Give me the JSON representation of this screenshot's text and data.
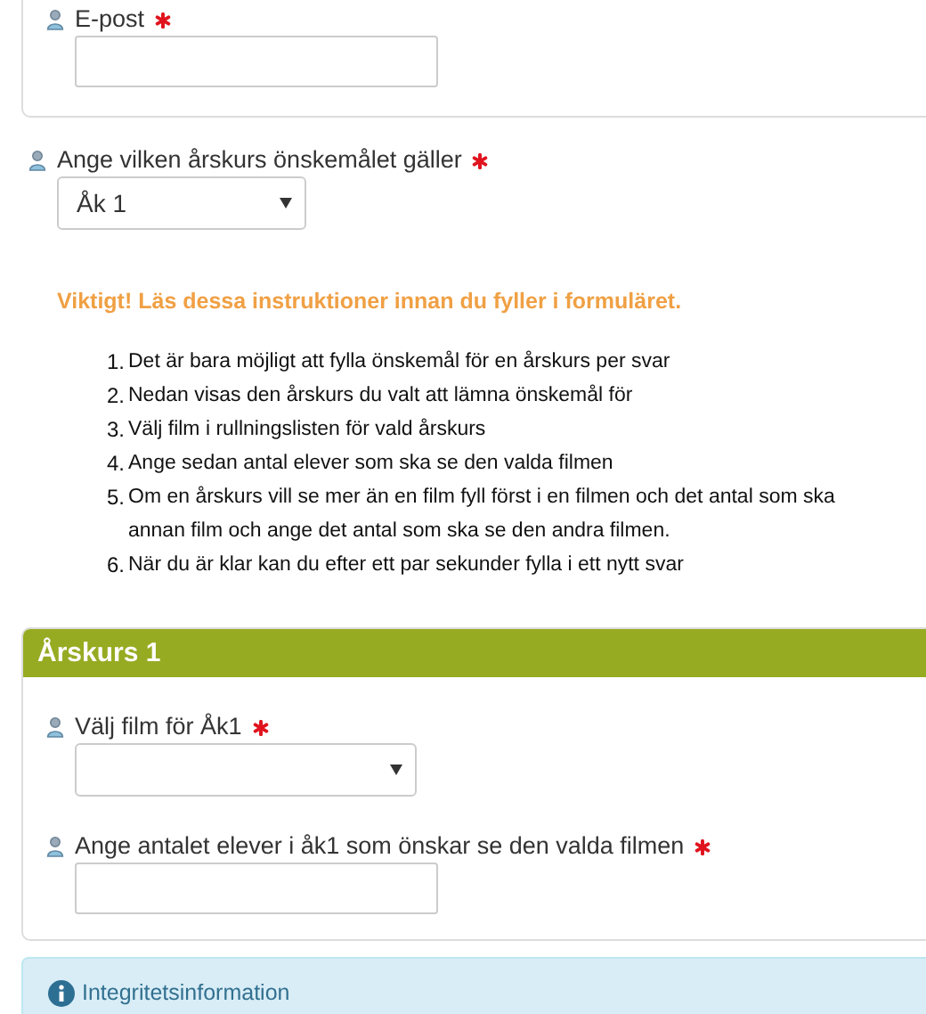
{
  "contact_card": {
    "fields": [
      {
        "label": "E-post",
        "required": true,
        "kind": "text"
      }
    ]
  },
  "grade_question": {
    "label": "Ange vilken årskurs önskemålet gäller",
    "required": true,
    "kind": "select",
    "value": "Åk 1"
  },
  "instructions": {
    "heading": "Viktigt! Läs dessa instruktioner innan du fyller i formuläret.",
    "items": [
      {
        "number": "1.",
        "lines": [
          "Det är bara möjligt att fylla önskemål för en årskurs per svar"
        ]
      },
      {
        "number": "2.",
        "lines": [
          "Nedan visas den årskurs du valt att lämna önskemål för"
        ]
      },
      {
        "number": "3.",
        "lines": [
          "Välj film i rullningslisten för vald årskurs"
        ]
      },
      {
        "number": "4.",
        "lines": [
          "Ange sedan antal elever som ska se den valda filmen"
        ]
      },
      {
        "number": "5.",
        "lines": [
          "Om en årskurs vill se mer än en film fyll först i en filmen och det antal som ska",
          "annan film och ange det antal som ska se den andra filmen."
        ]
      },
      {
        "number": "6.",
        "lines": [
          "När du är klar kan du efter ett par sekunder fylla i ett nytt svar"
        ]
      }
    ]
  },
  "grade_section": {
    "title": "Årskurs 1",
    "fields": [
      {
        "label": "Välj film för Åk1",
        "required": true,
        "kind": "select"
      },
      {
        "label": "Ange antalet elever i åk1 som önskar se den valda filmen",
        "required": true,
        "kind": "text"
      }
    ]
  },
  "privacy_bar": {
    "label": "Integritetsinformation"
  }
}
